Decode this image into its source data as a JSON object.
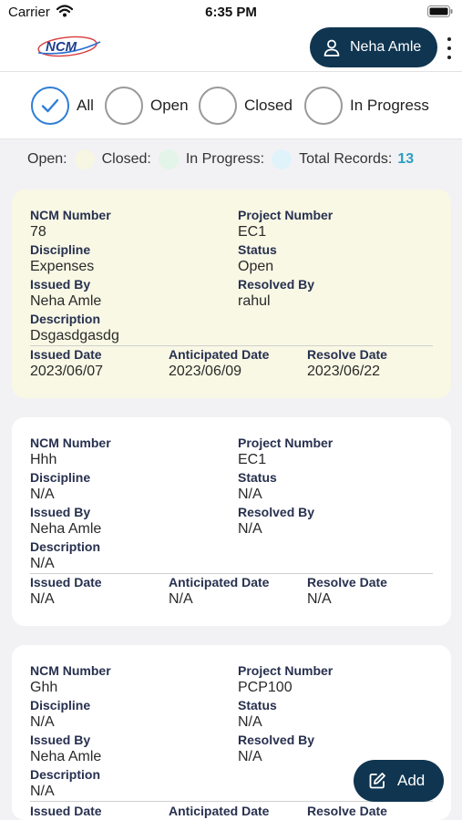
{
  "status_bar": {
    "carrier": "Carrier",
    "time": "6:35 PM"
  },
  "header": {
    "logo_text": "NCM",
    "user_name": "Neha Amle",
    "icons": {
      "user": "user-icon",
      "more": "more-vert-icon"
    }
  },
  "filters": [
    {
      "label": "All",
      "selected": true
    },
    {
      "label": "Open",
      "selected": false
    },
    {
      "label": "Closed",
      "selected": false
    },
    {
      "label": "In Progress",
      "selected": false
    }
  ],
  "legend": {
    "open_label": "Open:",
    "closed_label": "Closed:",
    "in_progress_label": "In Progress:",
    "total_label": "Total Records:",
    "total_value": "13",
    "colors": {
      "open": "#f7f6e3",
      "closed": "#e3f5e9",
      "in_progress": "#e0f3fa"
    }
  },
  "field_labels": {
    "ncm_number": "NCM Number",
    "project_number": "Project Number",
    "discipline": "Discipline",
    "status": "Status",
    "issued_by": "Issued By",
    "resolved_by": "Resolved By",
    "description": "Description",
    "issued_date": "Issued Date",
    "anticipated_date": "Anticipated Date",
    "resolve_date": "Resolve Date"
  },
  "records": [
    {
      "ncm_number": "78",
      "project_number": "EC1",
      "discipline": "Expenses",
      "status": "Open",
      "issued_by": "Neha Amle",
      "resolved_by": "rahul",
      "description": "Dsgasdgasdg",
      "issued_date": "2023/06/07",
      "anticipated_date": "2023/06/09",
      "resolve_date": "2023/06/22"
    },
    {
      "ncm_number": "Hhh",
      "project_number": "EC1",
      "discipline": "N/A",
      "status": "N/A",
      "issued_by": "Neha Amle",
      "resolved_by": "N/A",
      "description": "N/A",
      "issued_date": "N/A",
      "anticipated_date": "N/A",
      "resolve_date": "N/A"
    },
    {
      "ncm_number": "Ghh",
      "project_number": "PCP100",
      "discipline": "N/A",
      "status": "N/A",
      "issued_by": "Neha Amle",
      "resolved_by": "N/A",
      "description": "N/A",
      "issued_date": "",
      "anticipated_date": "",
      "resolve_date": ""
    }
  ],
  "add_button": {
    "label": "Add",
    "icon": "edit-icon"
  },
  "colors": {
    "accent": "#0f3550",
    "selected": "#2f7fd6",
    "count": "#2a9ec2",
    "open_card": "#f8f8e5"
  }
}
